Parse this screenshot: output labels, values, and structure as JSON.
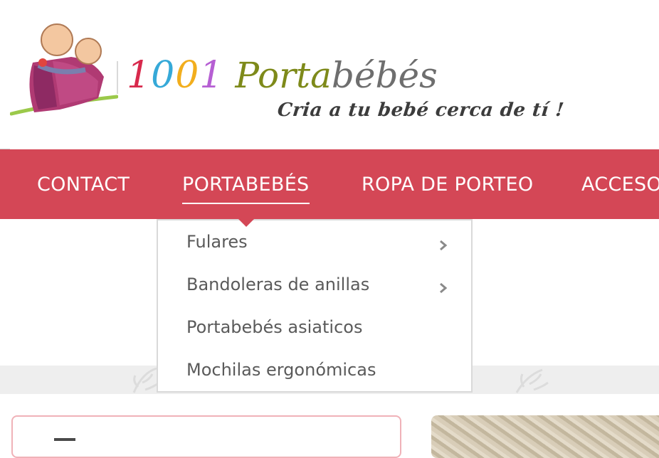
{
  "brand": {
    "digits": [
      {
        "char": "1",
        "color": "#d8294c"
      },
      {
        "char": "0",
        "color": "#36a9d8"
      },
      {
        "char": "0",
        "color": "#f2ae1d"
      },
      {
        "char": "1",
        "color": "#b65fd3"
      }
    ],
    "word_part1": "Porta",
    "word_part2": "bébés",
    "tagline": "Cria a tu bebé cerca de tí !",
    "logo_icon": "babywearing-parent-logo-icon"
  },
  "nav": {
    "items": [
      {
        "label": "CONTACT"
      },
      {
        "label": "PORTABEBÉS",
        "active": true
      },
      {
        "label": "ROPA DE PORTEO"
      },
      {
        "label": "ACCESO"
      }
    ],
    "background": "#d44756"
  },
  "dropdown": {
    "items": [
      {
        "label": "Fulares",
        "has_submenu": true
      },
      {
        "label": "Bandoleras de anillas",
        "has_submenu": true
      },
      {
        "label": "Portabebés asiaticos",
        "has_submenu": false
      },
      {
        "label": "Mochilas ergonómicas",
        "has_submenu": false
      }
    ],
    "submenu_icon": "chevron-right-icon"
  },
  "colors": {
    "accent": "#d44756",
    "card_border": "#f0b2b8",
    "menu_text": "#5a5a5a"
  }
}
